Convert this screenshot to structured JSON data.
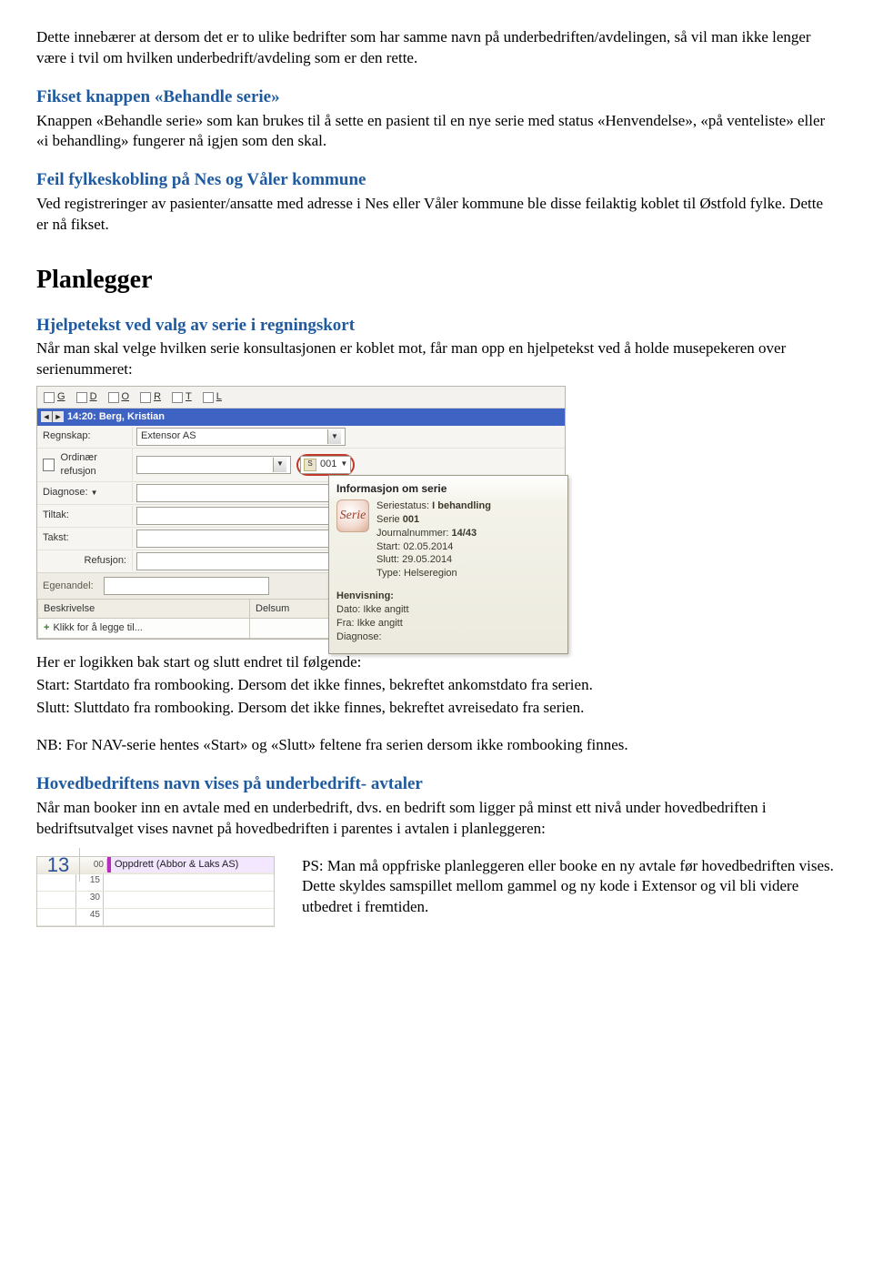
{
  "intro_paragraph": "Dette innebærer at dersom det er to ulike bedrifter som har samme navn på underbedriften/avdelingen, så vil man ikke lenger være i tvil om hvilken underbedrift/avdeling som er den rette.",
  "section1": {
    "heading": "Fikset knappen «Behandle serie»",
    "body": "Knappen «Behandle serie» som kan brukes til å sette en pasient til en nye serie med status «Henvendelse», «på venteliste» eller «i behandling» fungerer nå igjen som den skal."
  },
  "section2": {
    "heading": "Feil fylkeskobling på Nes og Våler kommune",
    "body": "Ved registreringer av pasienter/ansatte med adresse i Nes eller Våler kommune ble disse feilaktig koblet til Østfold fylke. Dette er nå fikset."
  },
  "planlegger_title": "Planlegger",
  "section3": {
    "heading": "Hjelpetekst ved valg av serie i regningskort",
    "body": "Når man skal velge hvilken serie konsultasjonen er koblet mot, får man opp en hjelpetekst ved å holde musepekeren over serienummeret:"
  },
  "screenshot1": {
    "toolbar": [
      {
        "key": "G"
      },
      {
        "key": "D"
      },
      {
        "key": "O"
      },
      {
        "key": "R"
      },
      {
        "key": "T"
      },
      {
        "key": "L"
      }
    ],
    "tab_label": "14:20: Berg, Kristian",
    "labels": {
      "regnskap": "Regnskap:",
      "ordinaer": "Ordinær refusjon",
      "diagnose": "Diagnose:",
      "tiltak": "Tiltak:",
      "takst": "Takst:",
      "refusjon": "Refusjon:",
      "egenandel": "Egenandel:"
    },
    "regnskap_value": "Extensor AS",
    "serie_value": "001",
    "serie_prefix": "S",
    "grid_headers": {
      "beskrivelse": "Beskrivelse",
      "delsum": "Delsum"
    },
    "grid_add_row": "Klikk for å legge til...",
    "tooltip": {
      "title": "Informasjon om serie",
      "icon_text": "Serie",
      "lines": {
        "l1a": "Seriestatus: ",
        "l1b": "I behandling",
        "l2a": "Serie ",
        "l2b": "001",
        "l3a": "Journalnummer: ",
        "l3b": "14/43",
        "l4a": "Start: ",
        "l4b": "02.05.2014",
        "l5a": "Slutt: ",
        "l5b": "29.05.2014",
        "l6a": "Type: ",
        "l6b": "Helseregion"
      },
      "sub_title": "Henvisning:",
      "sub_lines": {
        "d1a": "Dato: ",
        "d1b": "Ikke angitt",
        "d2a": "Fra: ",
        "d2b": "Ikke angitt",
        "d3": "Diagnose:"
      }
    }
  },
  "after_ss1": {
    "line1": "Her er logikken bak start og slutt endret til følgende:",
    "line2": "Start: Startdato fra rombooking. Dersom det ikke finnes, bekreftet ankomstdato fra serien.",
    "line3": "Slutt: Sluttdato fra rombooking. Dersom det ikke finnes, bekreftet avreisedato fra serien.",
    "line4": "NB: For NAV-serie hentes «Start» og «Slutt» feltene fra serien dersom ikke rombooking finnes."
  },
  "section4": {
    "heading": "Hovedbedriftens navn vises på underbedrift- avtaler",
    "body": "Når man booker inn en avtale med en underbedrift, dvs. en bedrift som ligger på minst ett nivå under hovedbedriften i bedriftsutvalget vises navnet på hovedbedriften i parentes i avtalen i planleggeren:"
  },
  "screenshot2": {
    "hour": "13",
    "minutes": [
      "00",
      "15",
      "30",
      "45"
    ],
    "appointment": "Oppdrett (Abbor & Laks AS)"
  },
  "after_ss2": "PS: Man må oppfriske planleggeren eller booke en ny avtale før hovedbedriften vises. Dette skyldes samspillet mellom gammel og ny kode i Extensor og vil bli videre utbedret i fremtiden."
}
